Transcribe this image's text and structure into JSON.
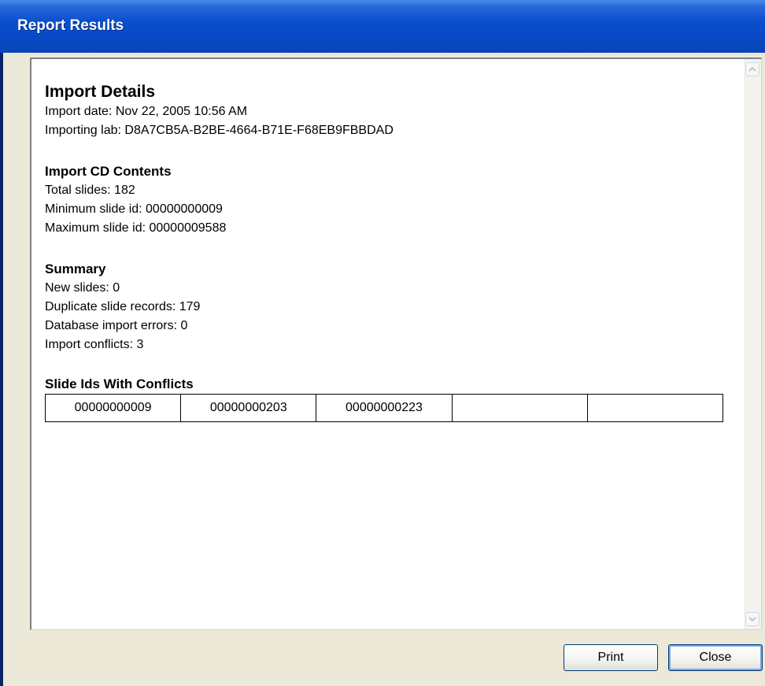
{
  "window": {
    "title": "Report Results"
  },
  "report": {
    "heading": "Import Details",
    "import_date": "Import date: Nov 22, 2005 10:56 AM",
    "importing_lab": "Importing lab: D8A7CB5A-B2BE-4664-B71E-F68EB9FBBDAD",
    "cd_contents": {
      "heading": "Import CD Contents",
      "total_slides": "Total slides: 182",
      "min_slide_id": "Minimum slide id: 00000000009",
      "max_slide_id": "Maximum slide id: 00000009588"
    },
    "summary": {
      "heading": "Summary",
      "new_slides": "New slides: 0",
      "duplicate_records": "Duplicate slide records: 179",
      "db_errors": "Database import errors: 0",
      "conflicts": "Import conflicts: 3"
    },
    "conflicts_table": {
      "heading": "Slide Ids With Conflicts",
      "cells": [
        "00000000009",
        "00000000203",
        "00000000223",
        "",
        ""
      ]
    }
  },
  "buttons": {
    "print": "Print",
    "close": "Close"
  },
  "icons": {
    "scroll_up": "scroll-up-arrow",
    "scroll_down": "scroll-down-arrow"
  }
}
